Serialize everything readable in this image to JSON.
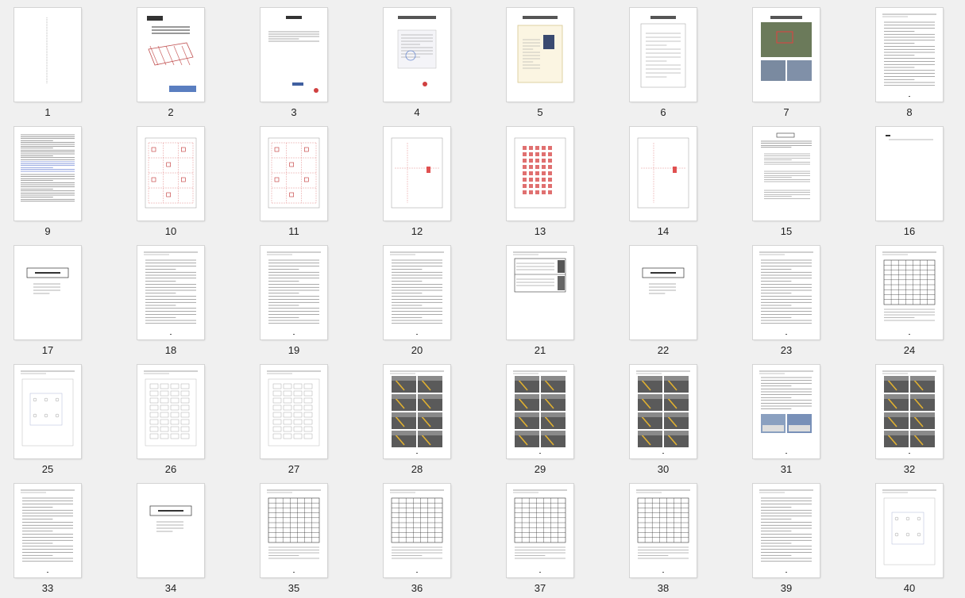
{
  "view": "page-thumbnail-grid",
  "columns": 8,
  "colors": {
    "background": "#f0f0f0",
    "page": "#ffffff",
    "drawing_line": "#e07a7a",
    "photo": "#5a5a5a",
    "highlight": "#e0b030"
  },
  "pages": [
    {
      "number": "1",
      "kind": "blank-margin"
    },
    {
      "number": "2",
      "kind": "cover"
    },
    {
      "number": "3",
      "kind": "letter"
    },
    {
      "number": "4",
      "kind": "certificate"
    },
    {
      "number": "5",
      "kind": "license"
    },
    {
      "number": "6",
      "kind": "form"
    },
    {
      "number": "7",
      "kind": "photos-aerial"
    },
    {
      "number": "8",
      "kind": "text"
    },
    {
      "number": "9",
      "kind": "text-dense"
    },
    {
      "number": "10",
      "kind": "drawing"
    },
    {
      "number": "11",
      "kind": "drawing"
    },
    {
      "number": "12",
      "kind": "drawing-sparse"
    },
    {
      "number": "13",
      "kind": "drawing-red"
    },
    {
      "number": "14",
      "kind": "drawing-sparse"
    },
    {
      "number": "15",
      "kind": "toc"
    },
    {
      "number": "16",
      "kind": "near-blank"
    },
    {
      "number": "17",
      "kind": "chapter"
    },
    {
      "number": "18",
      "kind": "text"
    },
    {
      "number": "19",
      "kind": "text"
    },
    {
      "number": "20",
      "kind": "text"
    },
    {
      "number": "21",
      "kind": "table-photos"
    },
    {
      "number": "22",
      "kind": "chapter"
    },
    {
      "number": "23",
      "kind": "text"
    },
    {
      "number": "24",
      "kind": "table"
    },
    {
      "number": "25",
      "kind": "drawing-small"
    },
    {
      "number": "26",
      "kind": "drawing-plan"
    },
    {
      "number": "27",
      "kind": "drawing-plan"
    },
    {
      "number": "28",
      "kind": "photos"
    },
    {
      "number": "29",
      "kind": "photos"
    },
    {
      "number": "30",
      "kind": "photos"
    },
    {
      "number": "31",
      "kind": "text-photos"
    },
    {
      "number": "32",
      "kind": "photos"
    },
    {
      "number": "33",
      "kind": "text"
    },
    {
      "number": "34",
      "kind": "chapter"
    },
    {
      "number": "35",
      "kind": "table"
    },
    {
      "number": "36",
      "kind": "table"
    },
    {
      "number": "37",
      "kind": "table"
    },
    {
      "number": "38",
      "kind": "table"
    },
    {
      "number": "39",
      "kind": "text"
    },
    {
      "number": "40",
      "kind": "drawing-small"
    }
  ]
}
